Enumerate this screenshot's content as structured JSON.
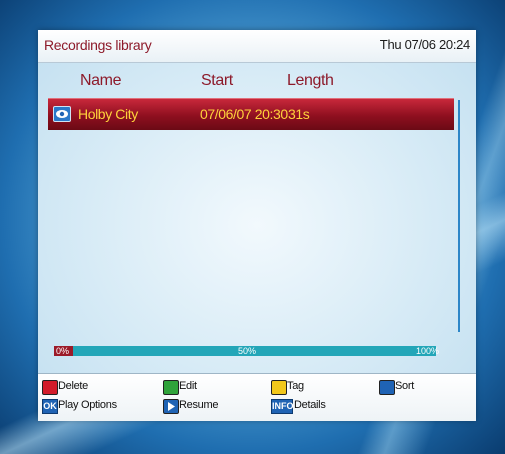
{
  "header": {
    "title": "Recordings library",
    "datetime": "Thu 07/06 20:24"
  },
  "columns": {
    "name": "Name",
    "start": "Start",
    "length": "Length"
  },
  "recordings": [
    {
      "name": "Holby City",
      "start": "07/06/07 20:30",
      "length": "31s",
      "icon": "eye-icon",
      "selected": true
    }
  ],
  "usage": {
    "label_min": "0%",
    "label_mid": "50%",
    "label_max": "100%",
    "used_percent": 5
  },
  "legend": {
    "delete": "Delete",
    "edit": "Edit",
    "tag": "Tag",
    "sort": "Sort",
    "ok_key": "OK",
    "play_options": "Play Options",
    "resume": "Resume",
    "info_key": "INFO",
    "details": "Details"
  },
  "colors": {
    "red": "#d21c2a",
    "green": "#2fa33a",
    "yellow": "#f2c81c",
    "blue": "#1f63b4",
    "accent": "#8d1a2a",
    "selection_text": "#ffd23b"
  }
}
